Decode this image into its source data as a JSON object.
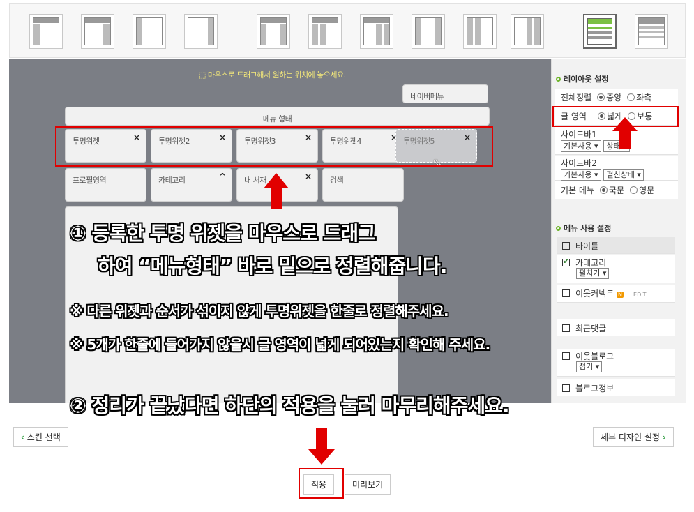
{
  "hint": "마우스로 드래그해서 원하는 위치에 놓으세요.",
  "widgets": {
    "nav_menu": "네이버메뉴",
    "menu_form": "메뉴 형태",
    "row1": [
      "투명위젯",
      "투명위젯2",
      "투명위젯3",
      "투명위젯4",
      "투명위젯5"
    ],
    "row2": [
      "프로필영역",
      "카테고리",
      "내 서재",
      "검색"
    ]
  },
  "sidebar": {
    "layout_title": "레이아웃 설정",
    "align_label": "전체정렬",
    "align_opt1": "중앙",
    "align_opt2": "좌측",
    "area_label": "글 영역",
    "area_opt1": "넓게",
    "area_opt2": "보통",
    "sidebar1": "사이드바1",
    "sidebar1_sel1": "기본사용",
    "sidebar1_sel2": "상태",
    "sidebar2": "사이드바2",
    "sidebar2_sel1": "기본사용",
    "sidebar2_sel2": "펼친상태",
    "menu_label": "기본 메뉴",
    "menu_opt1": "국문",
    "menu_opt2": "영문",
    "usage_title": "메뉴 사용 설정",
    "items": {
      "title": "타이틀",
      "category": "카테고리",
      "category_sel": "펼치기",
      "neighbor": "이웃커넥트",
      "neighbor_badge": "N",
      "edit": "EDIT",
      "recent": "최근댓글",
      "neighbor_blog": "이웃블로그",
      "neighbor_blog_sel": "접기",
      "blog_info": "블로그정보"
    }
  },
  "overlay": {
    "step1_line1": "① 등록한 투명 위젯을 마우스로 드래그",
    "step1_line2": "하여 “메뉴형태” 바로 밑으로 정렬해줍니다.",
    "note1": "※ 다른 위젯과 순서가 섞이지 않게 투명위젯을 한줄로 정렬해주세요.",
    "note2": "※ 5개가 한줄에 들어가지 않을시 글 영역이 넓게 되어있는지 확인해 주세요.",
    "step2": "② 정리가 끝났다면 하단의 적용을 눌러 마무리해주세요."
  },
  "bottom": {
    "skin_select": "스킨 선택",
    "detail_design": "세부 디자인 설정",
    "apply": "적용",
    "preview": "미리보기"
  },
  "colors": {
    "accent_red": "#e10000",
    "hint_yellow": "#f4e97a",
    "editor_gray": "#7b7e85"
  }
}
